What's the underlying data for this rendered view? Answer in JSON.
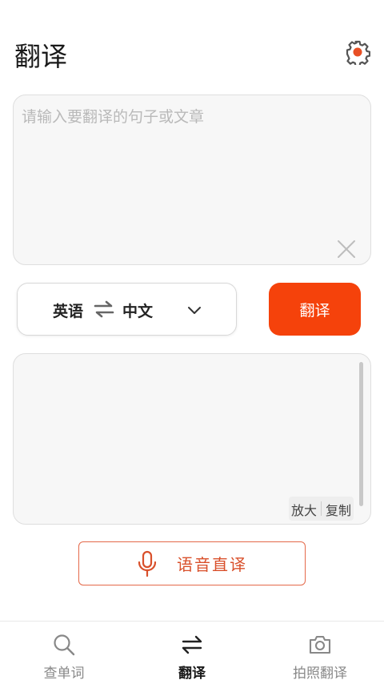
{
  "header": {
    "title": "翻译",
    "settings_icon": "gear-icon"
  },
  "input": {
    "placeholder": "请输入要翻译的句子或文章",
    "value": "",
    "clear_icon": "close-icon"
  },
  "language": {
    "source": "英语",
    "target": "中文",
    "swap_icon": "swap-arrows-icon",
    "dropdown_icon": "chevron-down-icon"
  },
  "translate_button": {
    "label": "翻译"
  },
  "output": {
    "text": "",
    "enlarge_label": "放大",
    "copy_label": "复制"
  },
  "voice": {
    "label": "语音直译",
    "icon": "microphone-icon"
  },
  "bottom_nav": {
    "items": [
      {
        "label": "查单词",
        "icon": "search-icon",
        "active": false
      },
      {
        "label": "翻译",
        "icon": "swap-arrows-icon",
        "active": true
      },
      {
        "label": "拍照翻译",
        "icon": "camera-icon",
        "active": false
      }
    ]
  },
  "colors": {
    "accent": "#f5420b",
    "voice_accent": "#d9502b",
    "settings_accent": "#e84f24"
  }
}
